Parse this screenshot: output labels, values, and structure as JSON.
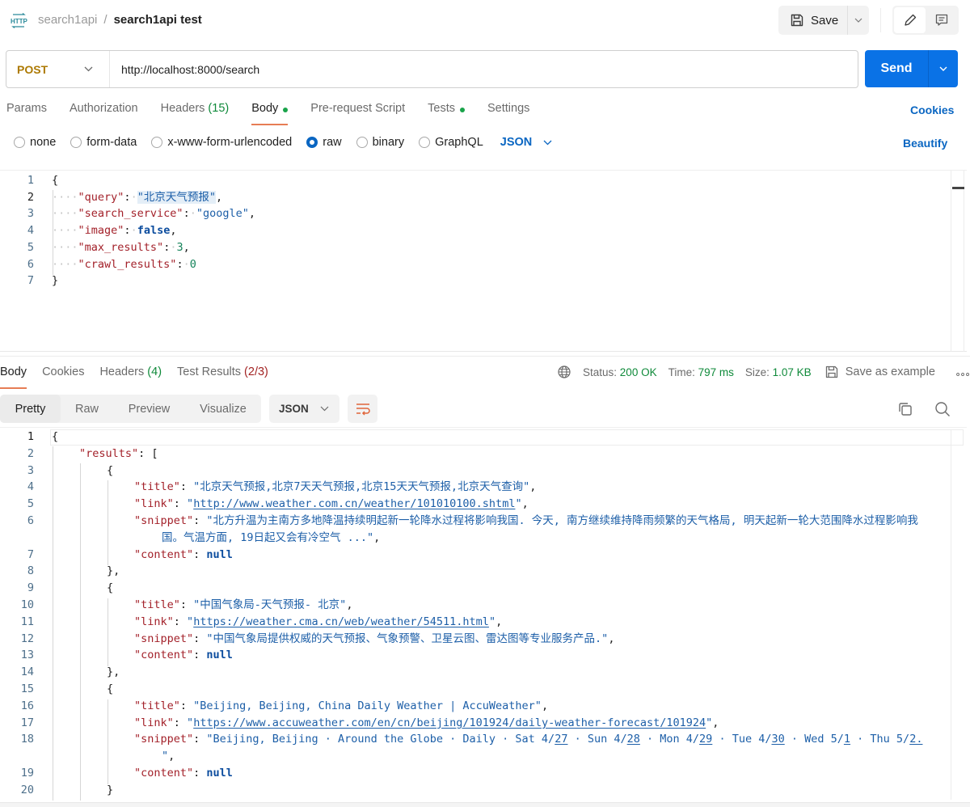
{
  "header": {
    "icon": "http-icon",
    "breadcrumb_parent": "search1api",
    "breadcrumb_sep": "/",
    "title": "search1api test",
    "save_label": "Save"
  },
  "request": {
    "method": "POST",
    "url": "http://localhost:8000/search",
    "send_label": "Send",
    "tabs": [
      {
        "label": "Params"
      },
      {
        "label": "Authorization"
      },
      {
        "label": "Headers",
        "count": "(15)"
      },
      {
        "label": "Body",
        "dot": true,
        "active": true
      },
      {
        "label": "Pre-request Script"
      },
      {
        "label": "Tests",
        "dot": true
      },
      {
        "label": "Settings"
      }
    ],
    "cookies_label": "Cookies",
    "body_types": [
      "none",
      "form-data",
      "x-www-form-urlencoded",
      "raw",
      "binary",
      "GraphQL"
    ],
    "body_type_selected": "raw",
    "language": "JSON",
    "beautify_label": "Beautify",
    "body_lines": [
      {
        "n": "1",
        "parts": [
          [
            "p",
            "{"
          ]
        ]
      },
      {
        "n": "2",
        "parts": [
          [
            "ws",
            "····"
          ],
          [
            "k",
            "\"query\""
          ],
          [
            "p",
            ":"
          ],
          [
            "ws",
            "·"
          ],
          [
            "s hl",
            "\"北京天气预报\""
          ],
          [
            "p",
            ","
          ]
        ]
      },
      {
        "n": "3",
        "parts": [
          [
            "ws",
            "····"
          ],
          [
            "k",
            "\"search_service\""
          ],
          [
            "p",
            ":"
          ],
          [
            "ws",
            "·"
          ],
          [
            "s",
            "\"google\""
          ],
          [
            "p",
            ","
          ]
        ]
      },
      {
        "n": "4",
        "parts": [
          [
            "ws",
            "····"
          ],
          [
            "k",
            "\"image\""
          ],
          [
            "p",
            ":"
          ],
          [
            "ws",
            "·"
          ],
          [
            "kw",
            "false"
          ],
          [
            "p",
            ","
          ]
        ]
      },
      {
        "n": "5",
        "parts": [
          [
            "ws",
            "····"
          ],
          [
            "k",
            "\"max_results\""
          ],
          [
            "p",
            ":"
          ],
          [
            "ws",
            "·"
          ],
          [
            "n",
            "3"
          ],
          [
            "p",
            ","
          ]
        ]
      },
      {
        "n": "6",
        "parts": [
          [
            "ws",
            "····"
          ],
          [
            "k",
            "\"crawl_results\""
          ],
          [
            "p",
            ":"
          ],
          [
            "ws",
            "·"
          ],
          [
            "n",
            "0"
          ]
        ]
      },
      {
        "n": "7",
        "parts": [
          [
            "p",
            "}"
          ]
        ]
      }
    ]
  },
  "response": {
    "tabs": [
      {
        "label": "Body",
        "active": true
      },
      {
        "label": "Cookies"
      },
      {
        "label": "Headers",
        "count": "(4)"
      },
      {
        "label": "Test Results",
        "count": "(2/3)"
      }
    ],
    "status_label": "Status:",
    "status_value": "200 OK",
    "time_label": "Time:",
    "time_value": "797 ms",
    "size_label": "Size:",
    "size_value": "1.07 KB",
    "save_example_label": "Save as example",
    "views": [
      "Pretty",
      "Raw",
      "Preview",
      "Visualize"
    ],
    "view_selected": "Pretty",
    "format": "JSON",
    "colors": {
      "ok": "#0f8a3a",
      "accent": "#e77d55",
      "link": "#0a66c2",
      "send": "#0a72e6"
    },
    "body_lines": [
      {
        "n": "1",
        "indent": 0,
        "parts": [
          [
            "p",
            "{"
          ]
        ]
      },
      {
        "n": "2",
        "indent": 1,
        "parts": [
          [
            "k",
            "\"results\""
          ],
          [
            "p",
            ": ["
          ]
        ]
      },
      {
        "n": "3",
        "indent": 2,
        "parts": [
          [
            "p",
            "{"
          ]
        ]
      },
      {
        "n": "4",
        "indent": 3,
        "parts": [
          [
            "k",
            "\"title\""
          ],
          [
            "p",
            ": "
          ],
          [
            "s",
            "\"北京天气预报,北京7天天气预报,北京15天天气预报,北京天气查询\""
          ],
          [
            "p",
            ","
          ]
        ]
      },
      {
        "n": "5",
        "indent": 3,
        "parts": [
          [
            "k",
            "\"link\""
          ],
          [
            "p",
            ": "
          ],
          [
            "s",
            "\""
          ],
          [
            "s u",
            "http://www.weather.com.cn/weather/101010100.shtml"
          ],
          [
            "s",
            "\""
          ],
          [
            "p",
            ","
          ]
        ]
      },
      {
        "n": "6",
        "indent": 3,
        "parts": [
          [
            "k",
            "\"snippet\""
          ],
          [
            "p",
            ": "
          ],
          [
            "s",
            "\"北方升温为主南方多地降温持续明起新一轮降水过程将影响我国. 今天, 南方继续维持降雨频繁的天气格局, 明天起新一轮大范围降水过程影响我"
          ]
        ]
      },
      {
        "n": "",
        "indent": 4,
        "parts": [
          [
            "s",
            "国。气温方面, 19日起又会有冷空气 ...\""
          ],
          [
            "p",
            ","
          ]
        ]
      },
      {
        "n": "7",
        "indent": 3,
        "parts": [
          [
            "k",
            "\"content\""
          ],
          [
            "p",
            ": "
          ],
          [
            "kw",
            "null"
          ]
        ]
      },
      {
        "n": "8",
        "indent": 2,
        "parts": [
          [
            "p",
            "},"
          ]
        ]
      },
      {
        "n": "9",
        "indent": 2,
        "parts": [
          [
            "p",
            "{"
          ]
        ]
      },
      {
        "n": "10",
        "indent": 3,
        "parts": [
          [
            "k",
            "\"title\""
          ],
          [
            "p",
            ": "
          ],
          [
            "s",
            "\"中国气象局-天气预报- 北京\""
          ],
          [
            "p",
            ","
          ]
        ]
      },
      {
        "n": "11",
        "indent": 3,
        "parts": [
          [
            "k",
            "\"link\""
          ],
          [
            "p",
            ": "
          ],
          [
            "s",
            "\""
          ],
          [
            "s u",
            "https://weather.cma.cn/web/weather/54511.html"
          ],
          [
            "s",
            "\""
          ],
          [
            "p",
            ","
          ]
        ]
      },
      {
        "n": "12",
        "indent": 3,
        "parts": [
          [
            "k",
            "\"snippet\""
          ],
          [
            "p",
            ": "
          ],
          [
            "s",
            "\"中国气象局提供权威的天气预报、气象预警、卫星云图、雷达图等专业服务产品.\""
          ],
          [
            "p",
            ","
          ]
        ]
      },
      {
        "n": "13",
        "indent": 3,
        "parts": [
          [
            "k",
            "\"content\""
          ],
          [
            "p",
            ": "
          ],
          [
            "kw",
            "null"
          ]
        ]
      },
      {
        "n": "14",
        "indent": 2,
        "parts": [
          [
            "p",
            "},"
          ]
        ]
      },
      {
        "n": "15",
        "indent": 2,
        "parts": [
          [
            "p",
            "{"
          ]
        ]
      },
      {
        "n": "16",
        "indent": 3,
        "parts": [
          [
            "k",
            "\"title\""
          ],
          [
            "p",
            ": "
          ],
          [
            "s",
            "\"Beijing, Beijing, China Daily Weather | AccuWeather\""
          ],
          [
            "p",
            ","
          ]
        ]
      },
      {
        "n": "17",
        "indent": 3,
        "parts": [
          [
            "k",
            "\"link\""
          ],
          [
            "p",
            ": "
          ],
          [
            "s",
            "\""
          ],
          [
            "s u",
            "https://www.accuweather.com/en/cn/beijing/101924/daily-weather-forecast/101924"
          ],
          [
            "s",
            "\""
          ],
          [
            "p",
            ","
          ]
        ]
      },
      {
        "n": "18",
        "indent": 3,
        "parts": [
          [
            "k",
            "\"snippet\""
          ],
          [
            "p",
            ": "
          ],
          [
            "s",
            "\"Beijing, Beijing · Around the Globe · Daily · Sat 4/"
          ],
          [
            "s u",
            "27"
          ],
          [
            "s",
            " · Sun 4/"
          ],
          [
            "s u",
            "28"
          ],
          [
            "s",
            " · Mon 4/"
          ],
          [
            "s u",
            "29"
          ],
          [
            "s",
            " · Tue 4/"
          ],
          [
            "s u",
            "30"
          ],
          [
            "s",
            " · Wed 5/"
          ],
          [
            "s u",
            "1"
          ],
          [
            "s",
            " · Thu 5/"
          ],
          [
            "s u",
            "2."
          ]
        ]
      },
      {
        "n": "",
        "indent": 4,
        "parts": [
          [
            "s",
            "\""
          ],
          [
            "p",
            ","
          ]
        ]
      },
      {
        "n": "19",
        "indent": 3,
        "parts": [
          [
            "k",
            "\"content\""
          ],
          [
            "p",
            ": "
          ],
          [
            "kw",
            "null"
          ]
        ]
      },
      {
        "n": "20",
        "indent": 2,
        "parts": [
          [
            "p",
            "}"
          ]
        ]
      }
    ]
  }
}
